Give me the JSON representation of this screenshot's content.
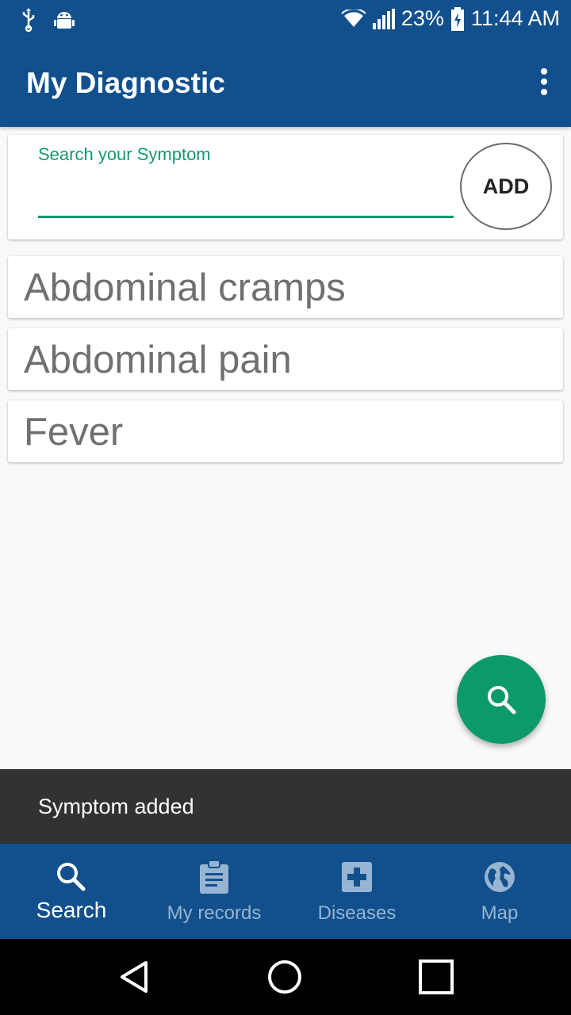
{
  "status_bar": {
    "left_icons": [
      "usb-icon",
      "android-debug-icon"
    ],
    "wifi_icon": "wifi-icon",
    "signal_icon": "signal-icon",
    "battery_percent": "23%",
    "battery_icon": "battery-charging-icon",
    "time": "11:44 AM"
  },
  "app_bar": {
    "title": "My Diagnostic",
    "menu_icon": "more-vert-icon",
    "color": "#11508c"
  },
  "search": {
    "label": "Search your Symptom",
    "value": "",
    "placeholder": "",
    "add_label": "ADD",
    "accent_color": "#139a6b"
  },
  "symptoms": [
    {
      "name": "Abdominal cramps"
    },
    {
      "name": "Abdominal pain"
    },
    {
      "name": "Fever"
    }
  ],
  "fab": {
    "icon": "search-icon",
    "color": "#0d9a69"
  },
  "snackbar": {
    "message": "Symptom added"
  },
  "bottom_nav": {
    "items": [
      {
        "label": "Search",
        "icon": "search-icon",
        "active": true
      },
      {
        "label": "My records",
        "icon": "clipboard-icon",
        "active": false
      },
      {
        "label": "Diseases",
        "icon": "medical-cross-icon",
        "active": false
      },
      {
        "label": "Map",
        "icon": "globe-icon",
        "active": false
      }
    ]
  },
  "system_nav": {
    "buttons": [
      "back-icon",
      "home-icon",
      "recents-icon"
    ]
  }
}
